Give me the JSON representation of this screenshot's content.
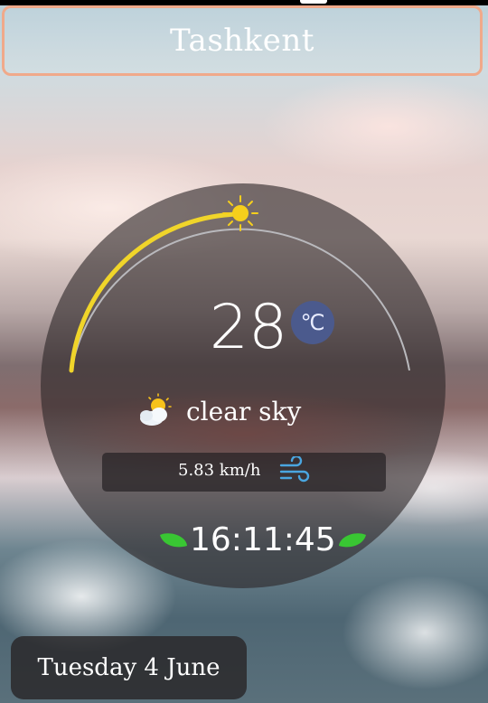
{
  "app": {
    "city": "Tashkent"
  },
  "weather": {
    "temperature": "28",
    "unit_symbol": "℃",
    "condition": "clear sky",
    "condition_icon": "sun-behind-cloud-icon",
    "wind_speed": "5.83 km/h",
    "wind_icon": "wind-icon",
    "sun_arc_progress": 0.5
  },
  "clock": {
    "time": "16:11:45"
  },
  "date": {
    "text": "Tuesday 4 June"
  },
  "colors": {
    "city_border": "#f0a98a",
    "sun_arc": "#f0d52a",
    "arc_track": "#b9b9bd",
    "unit_badge": "#4b5a8d",
    "leaf": "#39c633",
    "wind_icon": "#4aa6e0"
  }
}
